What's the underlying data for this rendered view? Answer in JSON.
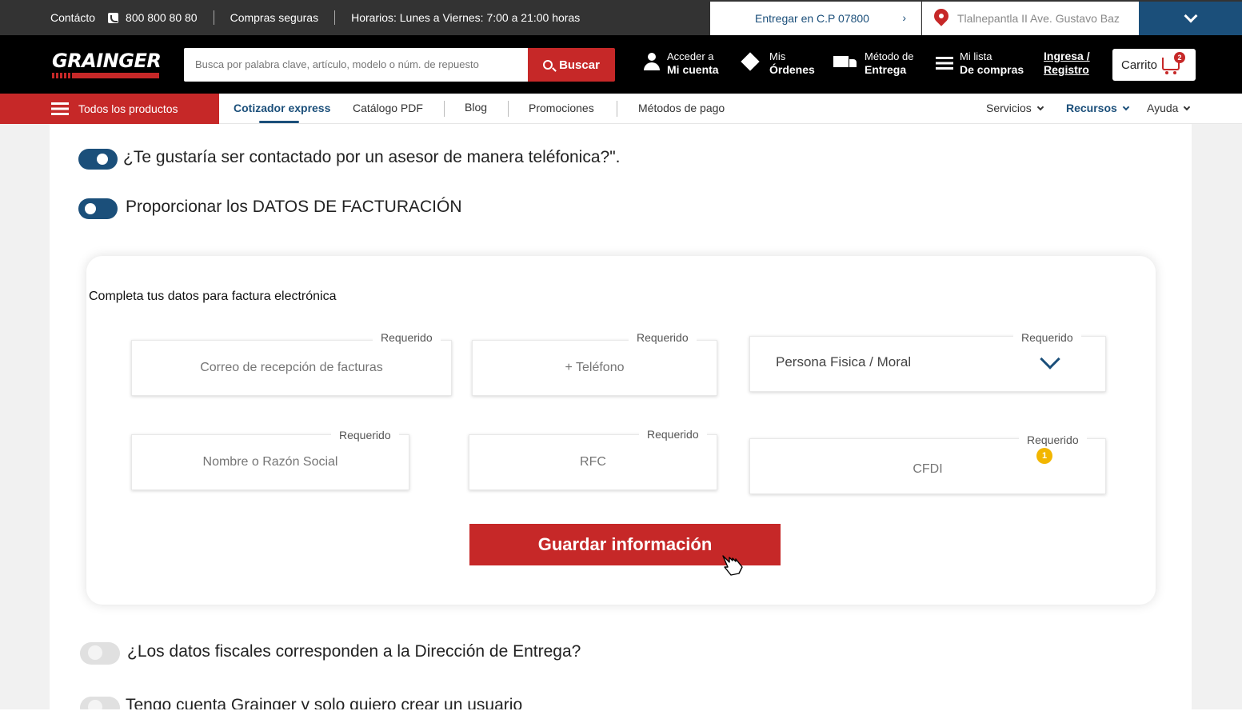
{
  "topbar": {
    "contact_label": "Contácto",
    "phone": "800 800 80 80",
    "secure": "Compras seguras",
    "hours": "Horarios: Lunes a Viernes: 7:00 a 21:00 horas",
    "deliver_to": "Entregar en C.P 07800",
    "location": "Tlalnepantla II  Ave. Gustavo Baz"
  },
  "header": {
    "logo": "GRAINGER",
    "search_placeholder": "Busca por palabra clave, artículo, modelo o núm. de repuesto",
    "search_button": "Buscar",
    "account_top": "Acceder a",
    "account_bottom": "Mi cuenta",
    "orders_top": "Mis",
    "orders_bottom": "Órdenes",
    "delivery_top": "Método de",
    "delivery_bottom": "Entrega",
    "list_top": "Mi lista",
    "list_bottom": "De compras",
    "login_top": "Ingresa /",
    "login_bottom": "Registro",
    "cart_label": "Carrito",
    "cart_count": "2"
  },
  "nav": {
    "all_products": "Todos los productos",
    "links": [
      "Cotizador express",
      "Catálogo PDF",
      "Blog",
      "Promociones",
      "Métodos de pago"
    ],
    "right": [
      "Servicios",
      "Recursos",
      "Ayuda"
    ]
  },
  "toggles": {
    "contact_phone": "¿Te gustaría ser contactado por un asesor de manera teléfonica?\".",
    "billing": "Proporcionar los DATOS DE FACTURACIÓN",
    "fiscal_address": "¿Los datos fiscales corresponden a la Dirección de Entrega?",
    "account": "Tengo cuenta Grainger y solo quiero crear un usuario"
  },
  "form": {
    "title": "Completa tus datos para factura electrónica",
    "required": "Requerido",
    "email_placeholder": "Correo de recepción de facturas",
    "phone_placeholder": "+ Teléfono",
    "person_type": "Persona Fisica / Moral",
    "name_placeholder": "Nombre o Razón Social",
    "rfc_placeholder": "RFC",
    "cfdi_placeholder": "CFDI",
    "cfdi_badge": "1",
    "save_button": "Guardar información"
  },
  "colors": {
    "brand_red": "#c62828",
    "brand_blue": "#1b4f7a",
    "warning": "#f2b600"
  }
}
